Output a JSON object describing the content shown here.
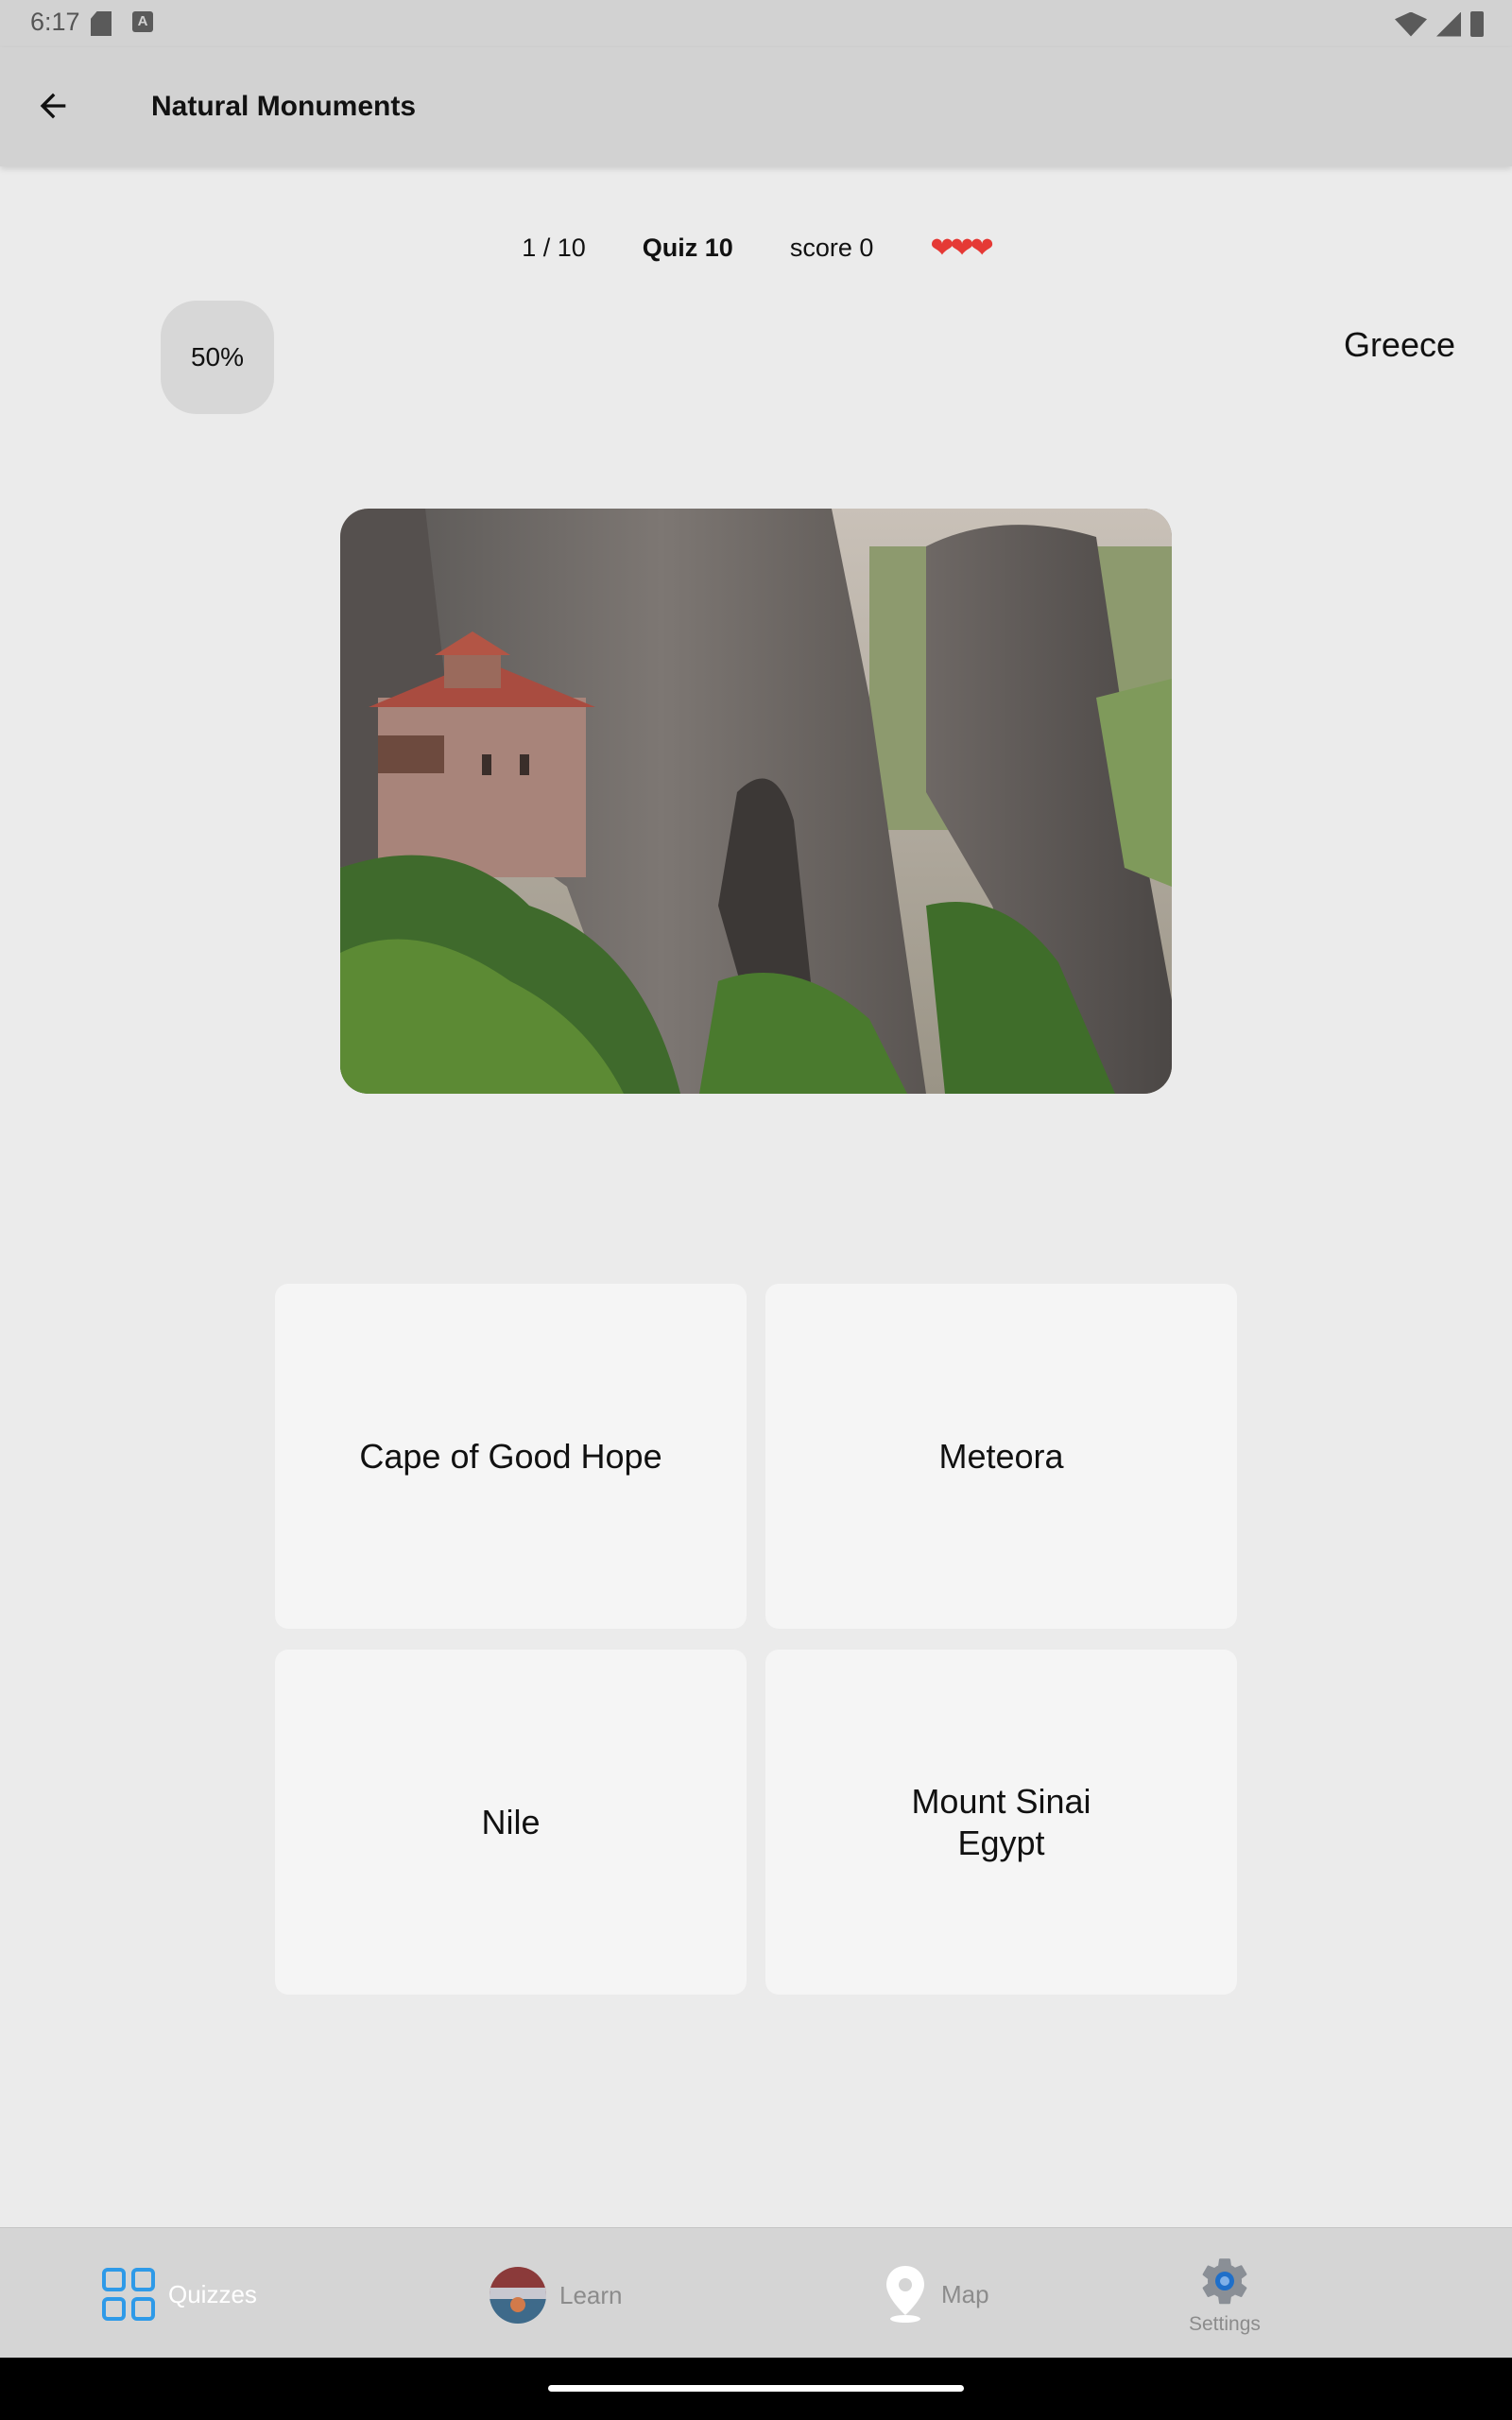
{
  "status_bar": {
    "time": "6:17"
  },
  "app_bar": {
    "title": "Natural Monuments"
  },
  "quiz_info": {
    "progress": "1 / 10",
    "quiz_name": "Quiz 10",
    "score": "score 0",
    "hearts": "❤❤❤"
  },
  "hint": {
    "percent": "50%",
    "country": "Greece"
  },
  "answers": [
    {
      "label": "Cape of Good Hope"
    },
    {
      "label": "Meteora"
    },
    {
      "label": "Nile"
    },
    {
      "label": "Mount Sinai\nEgypt"
    }
  ],
  "bottom_nav": {
    "quizzes": "Quizzes",
    "learn": "Learn",
    "map": "Map",
    "settings": "Settings"
  },
  "colors": {
    "accent": "#2e9ae8",
    "heart": "#e53935",
    "app_bar": "#d2d2d2",
    "background": "#ebebeb"
  }
}
